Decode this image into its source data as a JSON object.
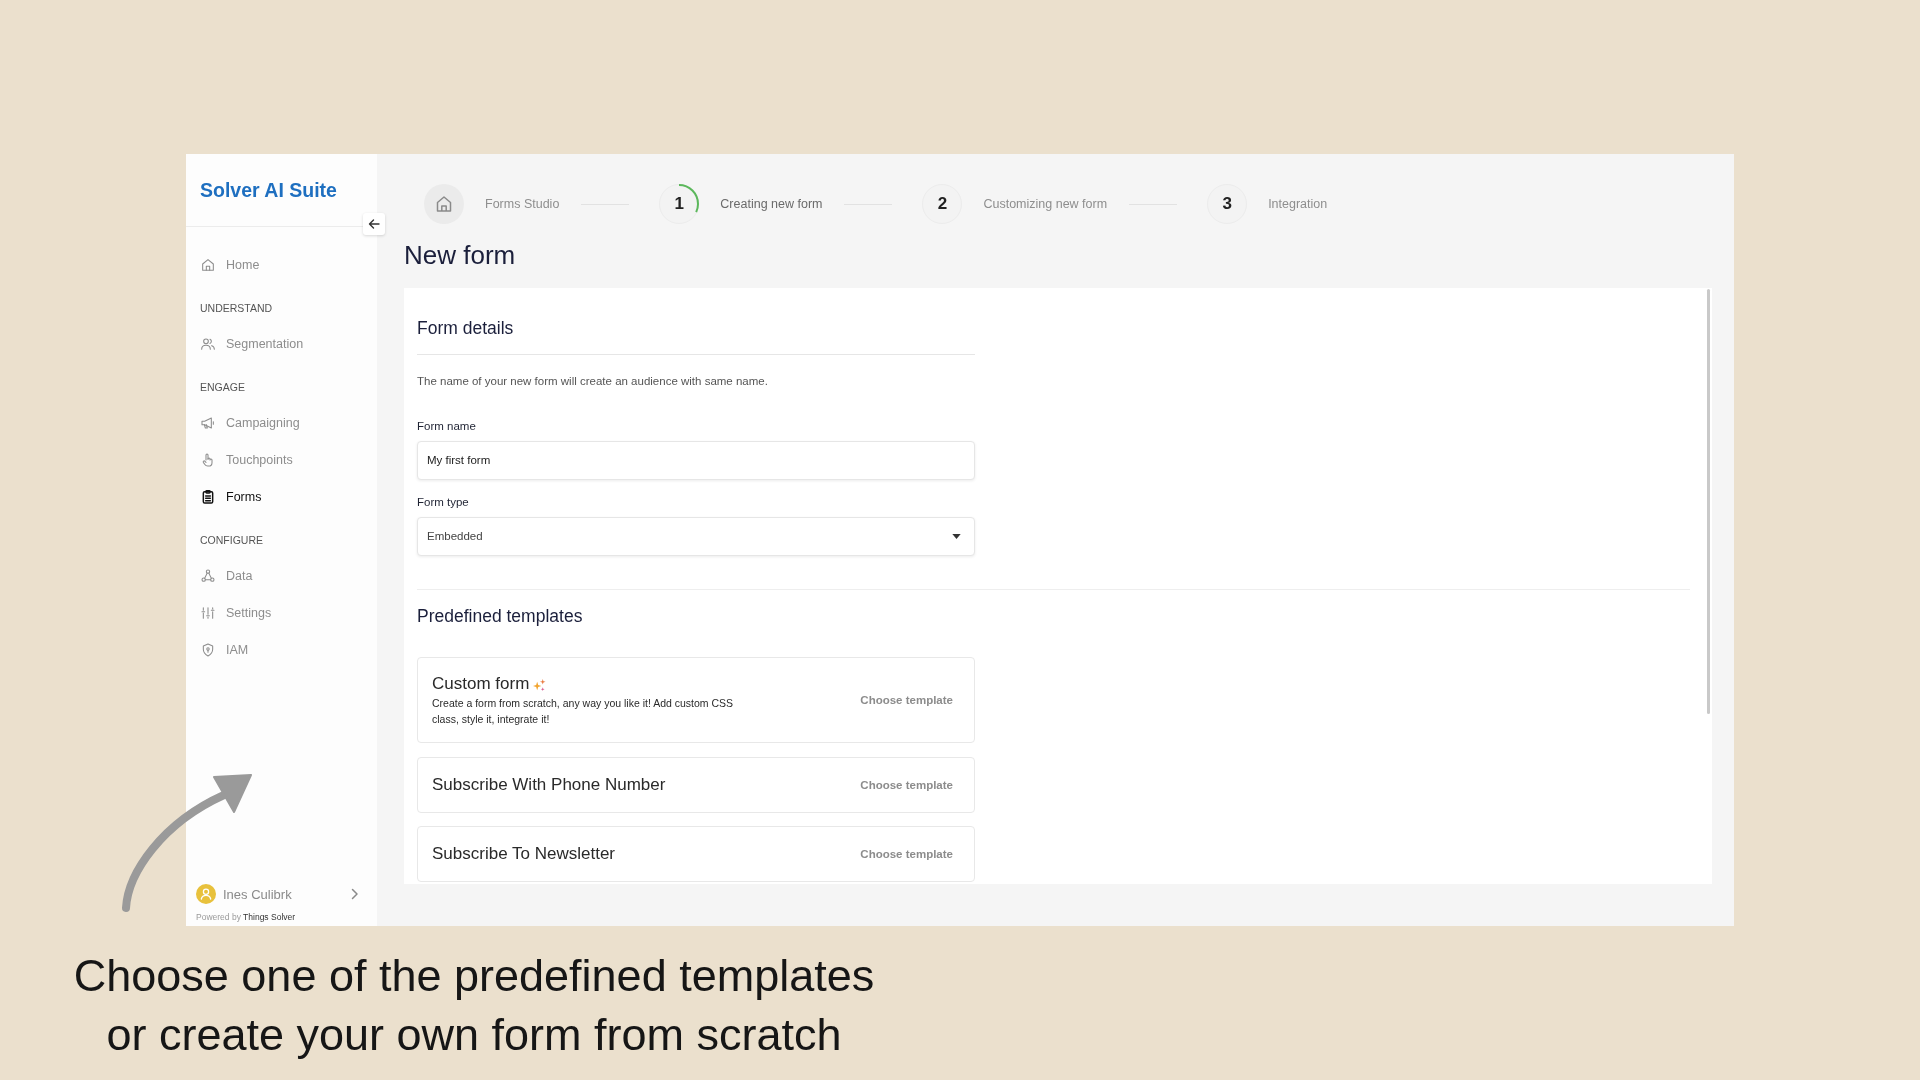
{
  "sidebar": {
    "logo": "Solver AI Suite",
    "items": [
      {
        "kind": "link",
        "label": "Home",
        "selected": false
      },
      {
        "kind": "heading",
        "label": "UNDERSTAND"
      },
      {
        "kind": "link",
        "label": "Segmentation",
        "selected": false
      },
      {
        "kind": "heading",
        "label": "ENGAGE"
      },
      {
        "kind": "link",
        "label": "Campaigning",
        "selected": false
      },
      {
        "kind": "link",
        "label": "Touchpoints",
        "selected": false
      },
      {
        "kind": "link",
        "label": "Forms",
        "selected": true
      },
      {
        "kind": "heading",
        "label": "CONFIGURE"
      },
      {
        "kind": "link",
        "label": "Data",
        "selected": false
      },
      {
        "kind": "link",
        "label": "Settings",
        "selected": false
      },
      {
        "kind": "link",
        "label": "IAM",
        "selected": false
      }
    ],
    "user": {
      "name": "Ines Culibrk"
    },
    "footer": {
      "text": "Powered by",
      "link": "Things Solver"
    }
  },
  "stepper": {
    "steps": [
      {
        "kind": "home",
        "label": "Forms Studio",
        "selected": false
      },
      {
        "kind": "number",
        "number": "1",
        "label": "Creating new form",
        "selected": true
      },
      {
        "kind": "number",
        "number": "2",
        "label": "Customizing new form",
        "selected": false
      },
      {
        "kind": "number",
        "number": "3",
        "label": "Integration",
        "selected": false
      }
    ]
  },
  "page_title": "New form",
  "form_details": {
    "title": "Form details",
    "description": "The name of your new form will create an audience with same name.",
    "fields": [
      {
        "kind": "text",
        "label": "Form name",
        "value": "My first form"
      },
      {
        "kind": "select",
        "label": "Form type",
        "value": "Embedded"
      }
    ]
  },
  "templates": {
    "title": "Predefined templates",
    "items": [
      {
        "kind": "custom",
        "title": "Custom form",
        "description": "Create a form from scratch, any way you like it! Add custom CSS class, style it, integrate it!",
        "action": "Choose template"
      },
      {
        "kind": "preset",
        "title": "Subscribe With Phone Number",
        "action": "Choose template"
      },
      {
        "kind": "preset",
        "title": "Subscribe To Newsletter",
        "action": "Choose template"
      }
    ]
  },
  "caption": {
    "lines": [
      "Choose one of the predefined templates",
      "or create your own form from scratch"
    ]
  }
}
